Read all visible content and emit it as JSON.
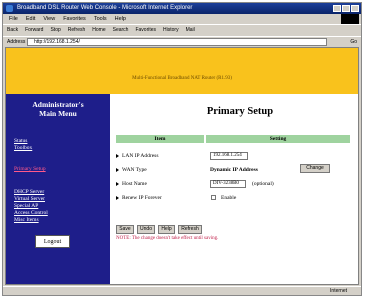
{
  "window": {
    "title": "Broadband DSL Router Web Console - Microsoft Internet Explorer"
  },
  "menu": [
    "File",
    "Edit",
    "View",
    "Favorites",
    "Tools",
    "Help"
  ],
  "toolbar": [
    "Back",
    "Forward",
    "Stop",
    "Refresh",
    "Home",
    "Search",
    "Favorites",
    "History",
    "Mail"
  ],
  "address": {
    "label": "Address",
    "value": "http://192.168.1.254/",
    "go": "Go"
  },
  "header": {
    "text": "Multi-Functional Broadband NAT Router (R1.93)"
  },
  "sidebar": {
    "title_line1": "Administrator's",
    "title_line2": "Main Menu",
    "links": [
      "Status",
      "Toolbox",
      "Primary Setup",
      "DHCP Server",
      "Virtual Server",
      "Special AP",
      "Access Control",
      "Misc Items"
    ],
    "logout": "Logout"
  },
  "main": {
    "title": "Primary Setup",
    "col_item": "Item",
    "col_setting": "Setting",
    "rows": [
      {
        "label": "LAN IP Address",
        "value": "192.168.1.254"
      },
      {
        "label": "WAN Type",
        "value": "Dynamic IP Address",
        "button": "Change"
      },
      {
        "label": "Host Name",
        "value": "DIV-3238B0",
        "hint": "(optional)"
      },
      {
        "label": "Renew IP Forever",
        "value": "Enable"
      }
    ],
    "buttons": [
      "Save",
      "Undo",
      "Help",
      "Refresh"
    ],
    "note": "NOTE: The change doesn't take effect until saving."
  },
  "status": {
    "zone": "Internet"
  }
}
